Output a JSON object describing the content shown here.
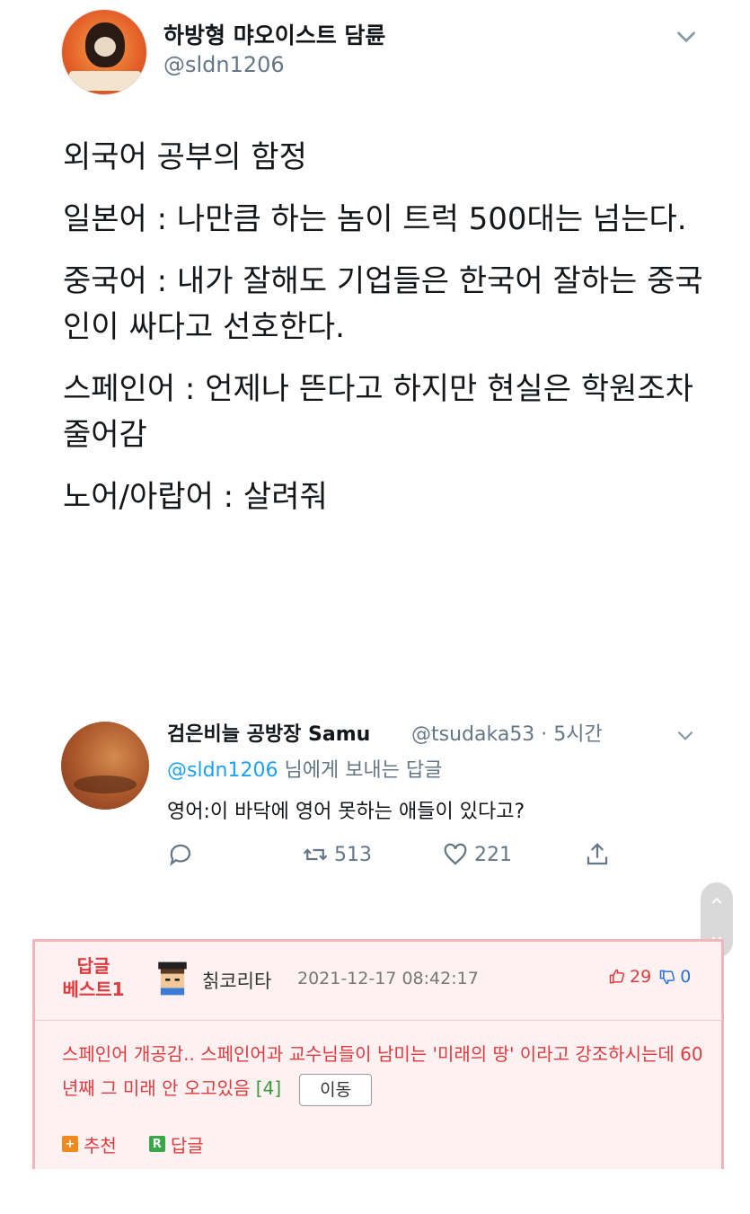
{
  "tweet": {
    "display_name": "하방형 먀오이스트 담륜",
    "handle": "@sldn1206",
    "lines": [
      "외국어 공부의 함정",
      "일본어 : 나만큼 하는 놈이 트럭 500대는 넘는다.",
      "중국어 : 내가 잘해도 기업들은 한국어 잘하는 중국인이 싸다고 선호한다.",
      "스페인어 : 언제나 뜬다고 하지만 현실은 학원조차 줄어감",
      "노어/아랍어 : 살려줘"
    ]
  },
  "reply": {
    "name": "검은비늘 공방장 Samu",
    "handle_time": "@tsudaka53 · 5시간",
    "reply_to_mention": "@sldn1206",
    "reply_to_suffix": " 님에게 보내는 답글",
    "text": "영어:이 바닥에 영어 못하는 애들이 있다고?",
    "retweets": "513",
    "likes": "221"
  },
  "comment": {
    "best_label_1": "답글",
    "best_label_2": "베스트1",
    "username": "칡코리타",
    "datetime": "2021-12-17 08:42:17",
    "upvotes": "29",
    "downvotes": "0",
    "text": "스페인어 개공감.. 스페인어과 교수님들이 남미는 '미래의 땅' 이라고 강조하시는데 60년째 그 미래 안 오고있음",
    "reply_count": "[4]",
    "move_button": "이동",
    "recommend_label": "추천",
    "reply_label": "답글",
    "recommend_icon_text": "+",
    "reply_icon_text": "R"
  },
  "colors": {
    "accent_blue": "#1da1f2",
    "comment_red": "#e03a3e",
    "comment_bg": "#fdf1f2"
  }
}
